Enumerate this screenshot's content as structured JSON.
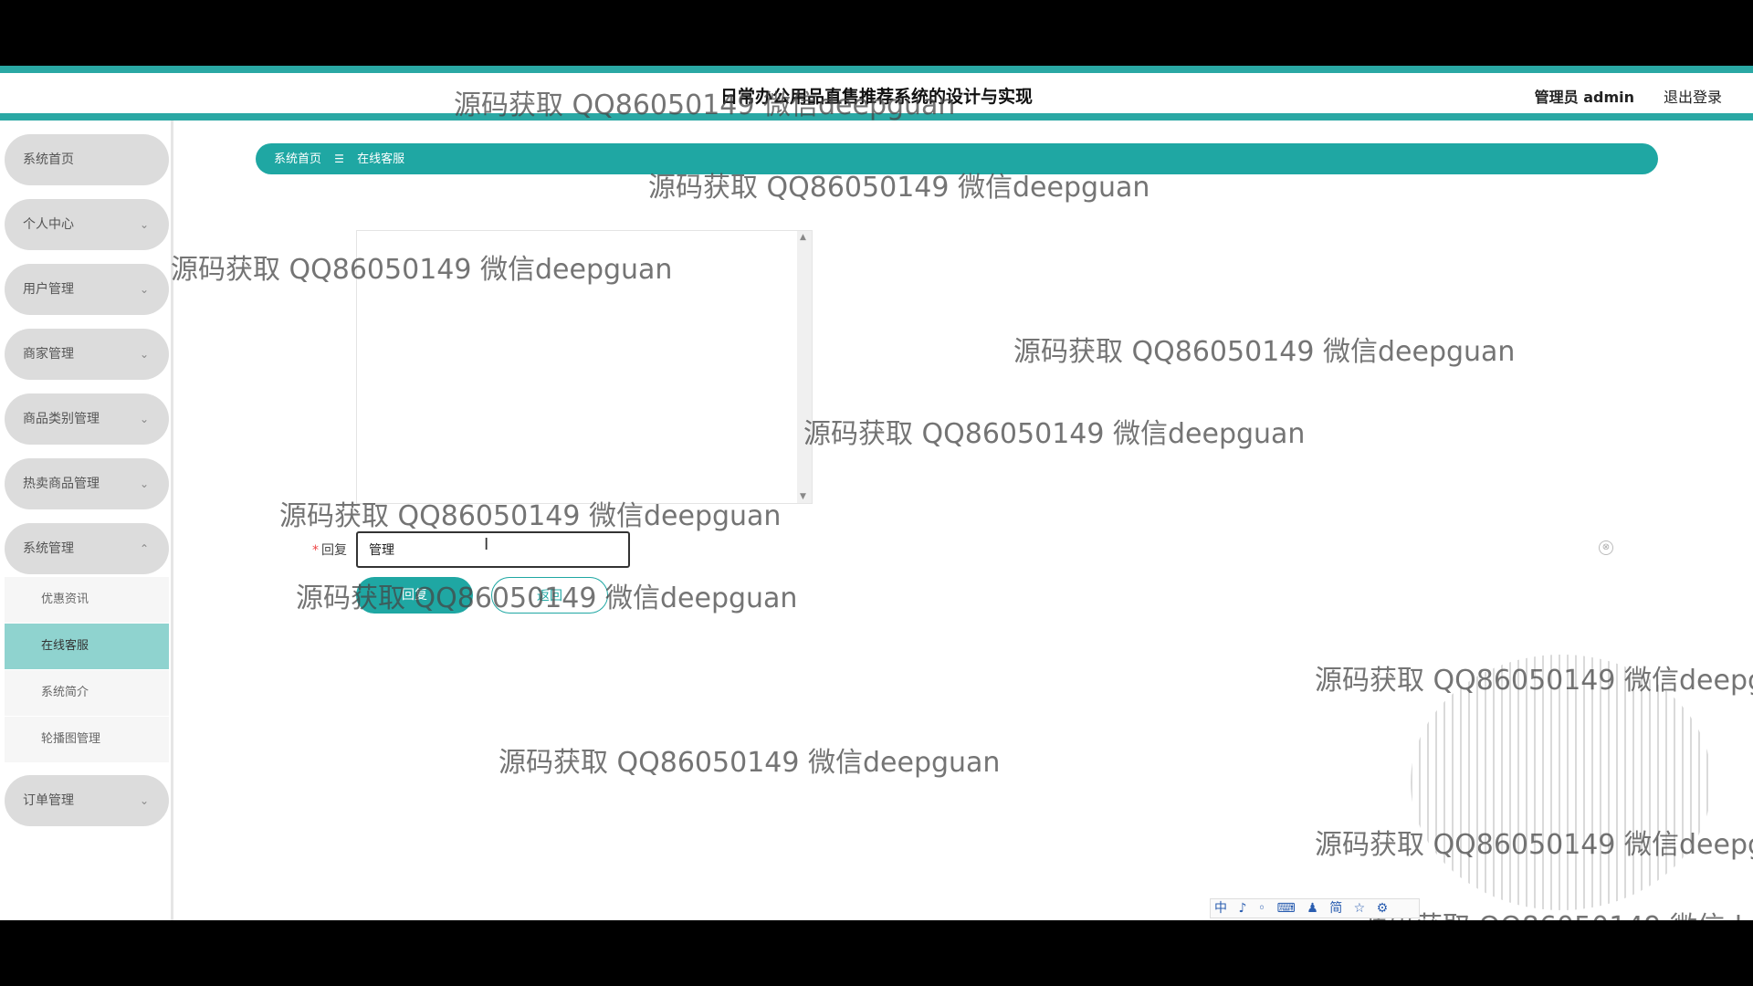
{
  "header": {
    "title": "日常办公用品直售推荐系统的设计与实现",
    "user_label": "管理员 admin",
    "logout_label": "退出登录"
  },
  "sidebar": {
    "items": [
      {
        "label": "系统首页",
        "chevron": ""
      },
      {
        "label": "个人中心",
        "chevron": "⌄"
      },
      {
        "label": "用户管理",
        "chevron": "⌄"
      },
      {
        "label": "商家管理",
        "chevron": "⌄"
      },
      {
        "label": "商品类别管理",
        "chevron": "⌄"
      },
      {
        "label": "热卖商品管理",
        "chevron": "⌄"
      },
      {
        "label": "系统管理",
        "chevron": "⌃"
      },
      {
        "label": "订单管理",
        "chevron": "⌄"
      }
    ],
    "subitems": [
      {
        "label": "优惠资讯",
        "active": false
      },
      {
        "label": "在线客服",
        "active": true
      },
      {
        "label": "系统简介",
        "active": false
      },
      {
        "label": "轮播图管理",
        "active": false
      }
    ]
  },
  "breadcrumb": {
    "home": "系统首页",
    "separator": "☰",
    "current": "在线客服"
  },
  "form": {
    "reply_label": "回复",
    "required_mark": "*",
    "reply_value": "管理",
    "reply_button": "回复",
    "back_button": "返回",
    "clear_icon": "⊗"
  },
  "watermark_text": "源码获取 QQ86050149 微信deepguan",
  "ime": {
    "text": "中 ♪ ◦ ⌨ ♟ 简 ☆ ⚙"
  },
  "colors": {
    "accent": "#1fa7a3",
    "active_submenu": "#8fd3cf",
    "menu_bg": "#dcdcdc"
  }
}
